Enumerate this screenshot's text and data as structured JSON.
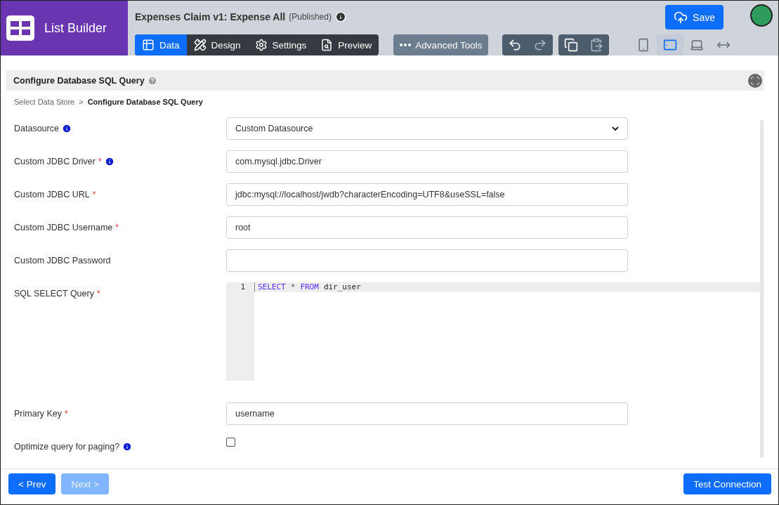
{
  "app": {
    "title": "List Builder"
  },
  "header": {
    "title": "Expenses Claim v1: Expense All",
    "status": "(Published)"
  },
  "tabs": [
    {
      "label": "Data",
      "selected": true
    },
    {
      "label": "Design",
      "selected": false
    },
    {
      "label": "Settings",
      "selected": false
    },
    {
      "label": "Preview",
      "selected": false
    }
  ],
  "advanced_tools": {
    "label": "Advanced Tools"
  },
  "save_button": {
    "label": "Save"
  },
  "devices": [
    {
      "kind": "phone",
      "selected": false
    },
    {
      "kind": "tablet",
      "selected": true
    },
    {
      "kind": "laptop",
      "selected": false
    },
    {
      "kind": "wide",
      "selected": false
    }
  ],
  "section": {
    "title": "Configure Database SQL Query"
  },
  "breadcrumb": {
    "separator": ">",
    "items": [
      {
        "label": "Select Data Store",
        "current": false
      },
      {
        "label": "Configure Database SQL Query",
        "current": true
      }
    ]
  },
  "fields": [
    {
      "kind": "select",
      "label": "Datasource",
      "required": false,
      "info": true,
      "value": "Custom Datasource"
    },
    {
      "kind": "text",
      "label": "Custom JDBC Driver",
      "required": true,
      "info": true,
      "value": "com.mysql.jdbc.Driver"
    },
    {
      "kind": "text",
      "label": "Custom JDBC URL",
      "required": true,
      "info": false,
      "value": "jdbc:mysql://localhost/jwdb?characterEncoding=UTF8&useSSL=false"
    },
    {
      "kind": "text",
      "label": "Custom JDBC Username",
      "required": true,
      "info": false,
      "value": "root"
    },
    {
      "kind": "text",
      "label": "Custom JDBC Password",
      "required": false,
      "info": false
    },
    {
      "kind": "code",
      "label": "SQL SELECT Query",
      "required": true,
      "info": false,
      "line": "1",
      "tokens": [
        {
          "text": "SELECT",
          "kind": "keyword"
        },
        {
          "text": "*",
          "kind": "operator"
        },
        {
          "text": "FROM",
          "kind": "keyword"
        },
        {
          "text": "dir_user",
          "kind": "name"
        }
      ]
    },
    {
      "kind": "text",
      "label": "Primary Key",
      "required": true,
      "info": false,
      "value": "username"
    },
    {
      "kind": "checkbox",
      "label": "Optimize query for paging?",
      "required": false,
      "info": true,
      "checked": false
    }
  ],
  "footer": {
    "prev": {
      "label": "< Prev",
      "disabled": false
    },
    "next": {
      "label": "Next >",
      "disabled": true
    },
    "test": {
      "label": "Test Connection"
    }
  }
}
